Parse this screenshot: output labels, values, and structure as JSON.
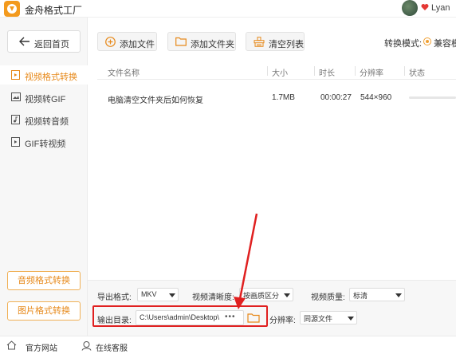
{
  "app": {
    "title": "金舟格式工厂",
    "user_name": "Lyan"
  },
  "sidebar": {
    "home_label": "返回首页",
    "items": [
      {
        "label": "视频格式转换",
        "active": true
      },
      {
        "label": "视频转GIF",
        "active": false
      },
      {
        "label": "视频转音频",
        "active": false
      },
      {
        "label": "GIF转视频",
        "active": false
      }
    ],
    "bottom_buttons": [
      "音频格式转换",
      "图片格式转换"
    ]
  },
  "toolbar": {
    "add_file": "添加文件",
    "add_folder": "添加文件夹",
    "clear_list": "清空列表",
    "mode_label": "转换模式:",
    "mode_value": "兼容模"
  },
  "table": {
    "headers": [
      "文件名称",
      "大小",
      "时长",
      "分辨率",
      "状态"
    ],
    "rows": [
      {
        "name": "电脑清空文件夹后如何恢复",
        "size": "1.7MB",
        "duration": "00:00:27",
        "resolution": "544×960",
        "progress": 0
      }
    ]
  },
  "settings": {
    "export_format_label": "导出格式:",
    "export_format_value": "MKV",
    "clarity_label": "视频清晰度:",
    "clarity_value": "按画质区分",
    "quality_label": "视频质量:",
    "quality_value": "标清",
    "output_dir_label": "输出目录:",
    "output_dir_value": "C:\\Users\\admin\\Desktop\\",
    "browse_dots": "•••",
    "resolution_label": "分辨率:",
    "resolution_value": "同源文件"
  },
  "footer": {
    "website": "官方网站",
    "support": "在线客服"
  },
  "colors": {
    "accent": "#f0a033",
    "highlight": "#e02020"
  }
}
